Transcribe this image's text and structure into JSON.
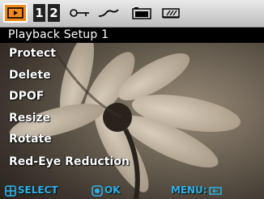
{
  "tabs": [
    {
      "name": "playback",
      "icon": "playback-icon",
      "active": true
    },
    {
      "label": "1"
    },
    {
      "label": "2"
    },
    {
      "name": "setup",
      "icon": "key-icon"
    },
    {
      "name": "curve",
      "icon": "curve-icon"
    },
    {
      "name": "camera",
      "icon": "camera-icon"
    },
    {
      "name": "battery",
      "icon": "battery-icon"
    }
  ],
  "title": "Playback Setup 1",
  "menu": {
    "items": [
      "Protect",
      "Delete",
      "DPOF",
      "Resize",
      "Rotate",
      "Red-Eye Reduction"
    ]
  },
  "hints": {
    "select": "SELECT",
    "ok": "OK",
    "menu": "MENU:"
  },
  "colors": {
    "accent": "#f08a1c",
    "hint": "#2fb0e8"
  }
}
